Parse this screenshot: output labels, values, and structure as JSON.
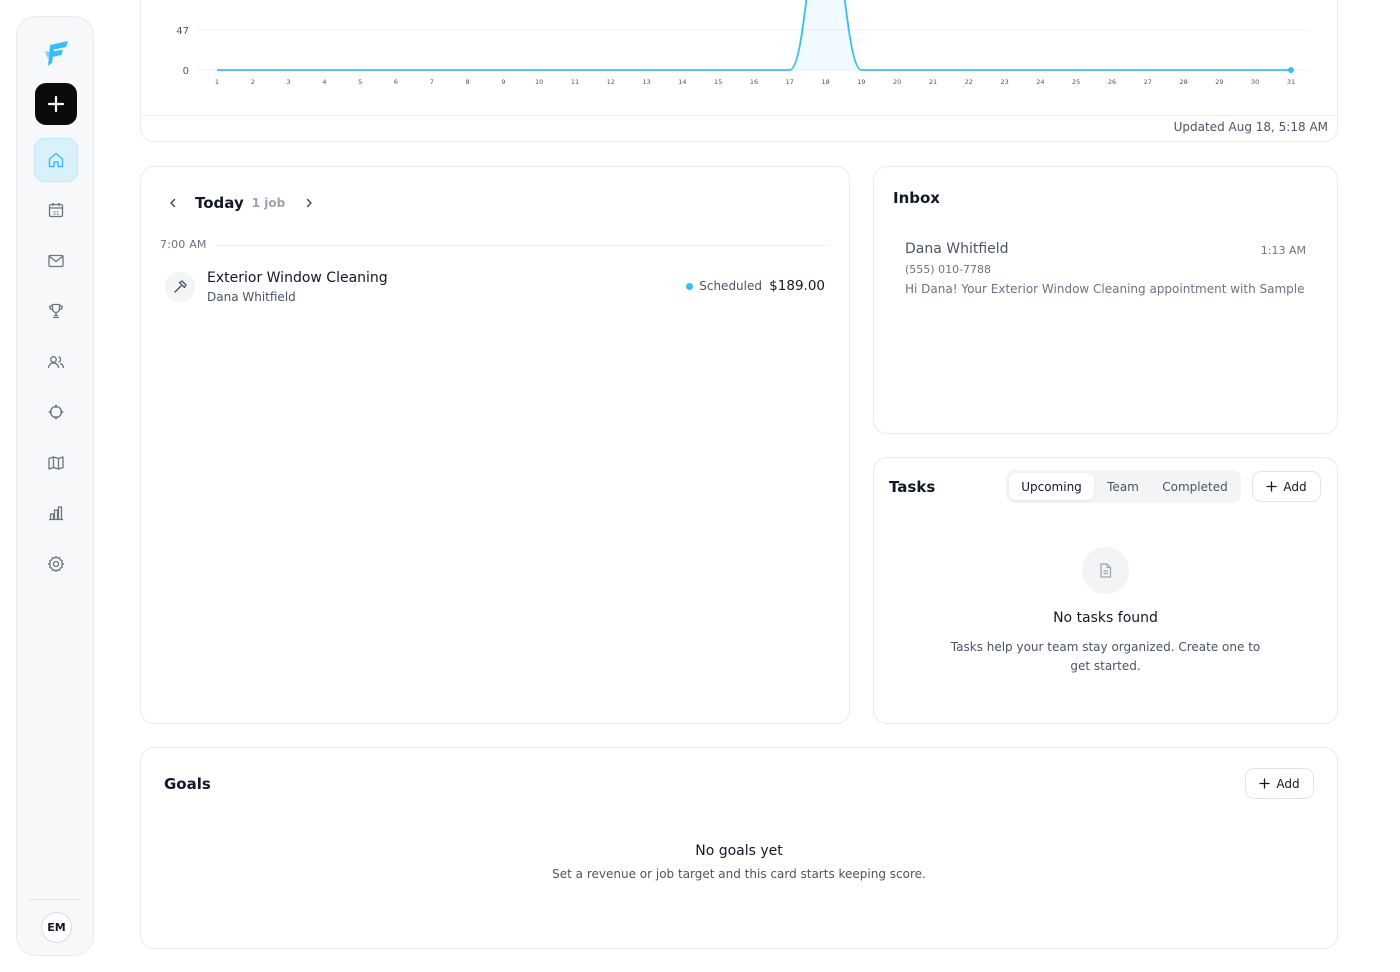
{
  "brand": {
    "accent": "#38bdf8",
    "active_bg": "#d9f1fb"
  },
  "sidebar": {
    "logo_icon": "flow-logo-icon",
    "new_icon": "plus-icon",
    "items": [
      {
        "name": "home",
        "icon": "home-icon",
        "active": true
      },
      {
        "name": "calendar",
        "icon": "calendar-icon",
        "label": "31"
      },
      {
        "name": "inbox",
        "icon": "mail-icon"
      },
      {
        "name": "goals",
        "icon": "trophy-icon"
      },
      {
        "name": "clients",
        "icon": "users-icon"
      },
      {
        "name": "target",
        "icon": "crosshair-icon"
      },
      {
        "name": "map",
        "icon": "map-icon"
      },
      {
        "name": "reports",
        "icon": "bar-chart-icon"
      },
      {
        "name": "settings",
        "icon": "gear-icon"
      }
    ],
    "avatar_initials": "EM"
  },
  "chart_data": {
    "type": "line",
    "x": [
      1,
      2,
      3,
      4,
      5,
      6,
      7,
      8,
      9,
      10,
      11,
      12,
      13,
      14,
      15,
      16,
      17,
      18,
      19,
      20,
      21,
      22,
      23,
      24,
      25,
      26,
      27,
      28,
      29,
      30,
      31
    ],
    "x_tick_labels": [
      "1",
      "2",
      "3",
      "4",
      "5",
      "6",
      "7",
      "8",
      "9",
      "10",
      "11",
      "12",
      "13",
      "14",
      "15",
      "16",
      "17",
      "18",
      "19",
      "20",
      "21",
      "22",
      "23",
      "24",
      "25",
      "26",
      "27",
      "28",
      "29",
      "30",
      "31"
    ],
    "series": [
      {
        "values": [
          0,
          0,
          0,
          0,
          0,
          0,
          0,
          0,
          0,
          0,
          0,
          0,
          0,
          0,
          0,
          0,
          0,
          189,
          0,
          0,
          0,
          0,
          0,
          0,
          0,
          0,
          0,
          0,
          0,
          0,
          0
        ]
      }
    ],
    "y_tick_labels": [
      "0",
      "47"
    ],
    "y_ticks": [
      0,
      47
    ],
    "color": "#38bdf8",
    "grid": true,
    "updated_text": "Updated Aug 18, 5:18 AM"
  },
  "schedule": {
    "title": "Today",
    "count": "1 job",
    "time_label": "7:00 AM",
    "job": {
      "icon": "hammer-icon",
      "title": "Exterior Window Cleaning",
      "client": "Dana Whitfield",
      "status": "Scheduled",
      "price": "$189.00"
    }
  },
  "inbox": {
    "title": "Inbox",
    "message": {
      "name": "Dana Whitfield",
      "time": "1:13 AM",
      "phone": "(555) 010-7788",
      "preview": "Hi Dana! Your Exterior Window Cleaning appointment with Sample Sh"
    }
  },
  "tasks": {
    "title": "Tasks",
    "tabs": [
      "Upcoming",
      "Team",
      "Completed"
    ],
    "selected_tab": "Upcoming",
    "add_label": "Add",
    "empty_icon": "document-icon",
    "empty_title": "No tasks found",
    "empty_desc": "Tasks help your team stay organized. Create one to get started."
  },
  "goals": {
    "title": "Goals",
    "add_label": "Add",
    "empty_title": "No goals yet",
    "empty_desc": "Set a revenue or job target and this card starts keeping score."
  }
}
